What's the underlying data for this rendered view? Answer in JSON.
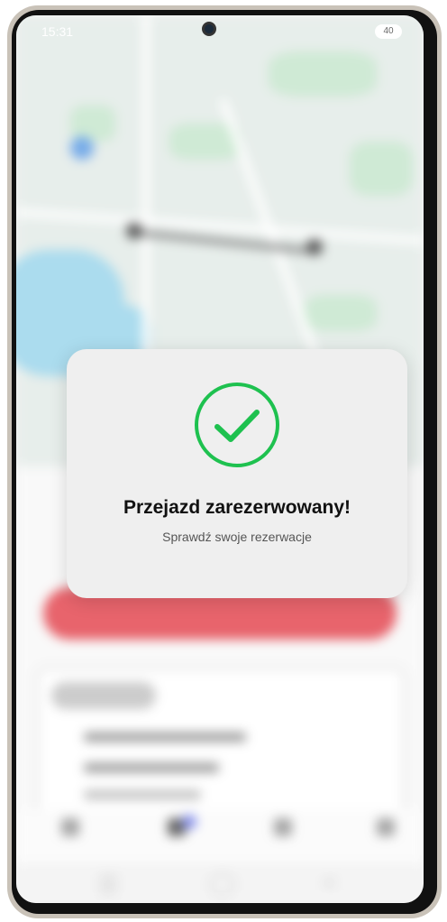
{
  "status_bar": {
    "time": "15:31",
    "battery": "40"
  },
  "modal": {
    "title": "Przejazd zarezerwowany!",
    "subtitle": "Sprawdź swoje rezerwacje",
    "icon": "check-circle-icon",
    "accent_color": "#1ec14f"
  }
}
